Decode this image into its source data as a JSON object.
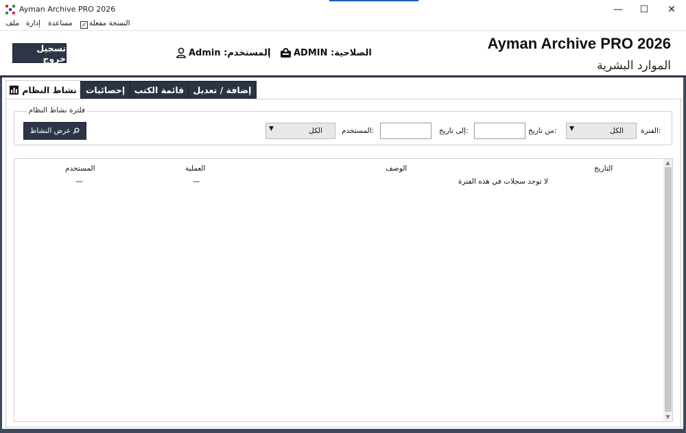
{
  "window": {
    "title": "Ayman Archive PRO 2026",
    "minimize": "—",
    "maximize": "☐",
    "close": "✕"
  },
  "menu": {
    "activated_copy": "النسخة مفعلة",
    "help": "مساعدة",
    "admin": "إدارة",
    "file": "ملف"
  },
  "header": {
    "logout_label": "تسجيل خروج",
    "user_text": "المستخدم: Admin",
    "separator": "|",
    "permission_text": "الصلاحية: ADMIN",
    "app_name": "Ayman Archive PRO 2026",
    "department": "الموارد البشرية"
  },
  "tabs": [
    {
      "label": "نشاط النظام",
      "active": true
    },
    {
      "label": "إحصائيات",
      "active": false
    },
    {
      "label": "قائمة الكتب",
      "active": false
    },
    {
      "label": "إضافة / تعديل",
      "active": false
    }
  ],
  "filter": {
    "group_title": "فلترة نشاط النظام",
    "period_label": ":الفترة",
    "period_value": "الكل",
    "from_label": ":من تاريخ",
    "from_value": "",
    "to_label": ":إلى تاريخ",
    "to_value": "",
    "user_label": ":المستخدم",
    "user_value": "الكل",
    "show_button": "عرض النشاط"
  },
  "table": {
    "columns": [
      "التاريخ",
      "الوصف",
      "العملية",
      "المستخدم"
    ],
    "rows": [
      [
        "",
        "لا توجد سجلات في هذه الفترة",
        "—",
        "—"
      ]
    ]
  },
  "colors": {
    "dark_navy": "#2b3442",
    "button_bg": "#2d3646",
    "title_accent": "#1f5fbf"
  },
  "icons": {
    "app": "app-grid-icon",
    "user": "user-icon",
    "permission": "key-badge-icon",
    "activity_tab": "bar-chart-icon",
    "search": "search-icon",
    "dropdown": "chevron-down-icon"
  }
}
